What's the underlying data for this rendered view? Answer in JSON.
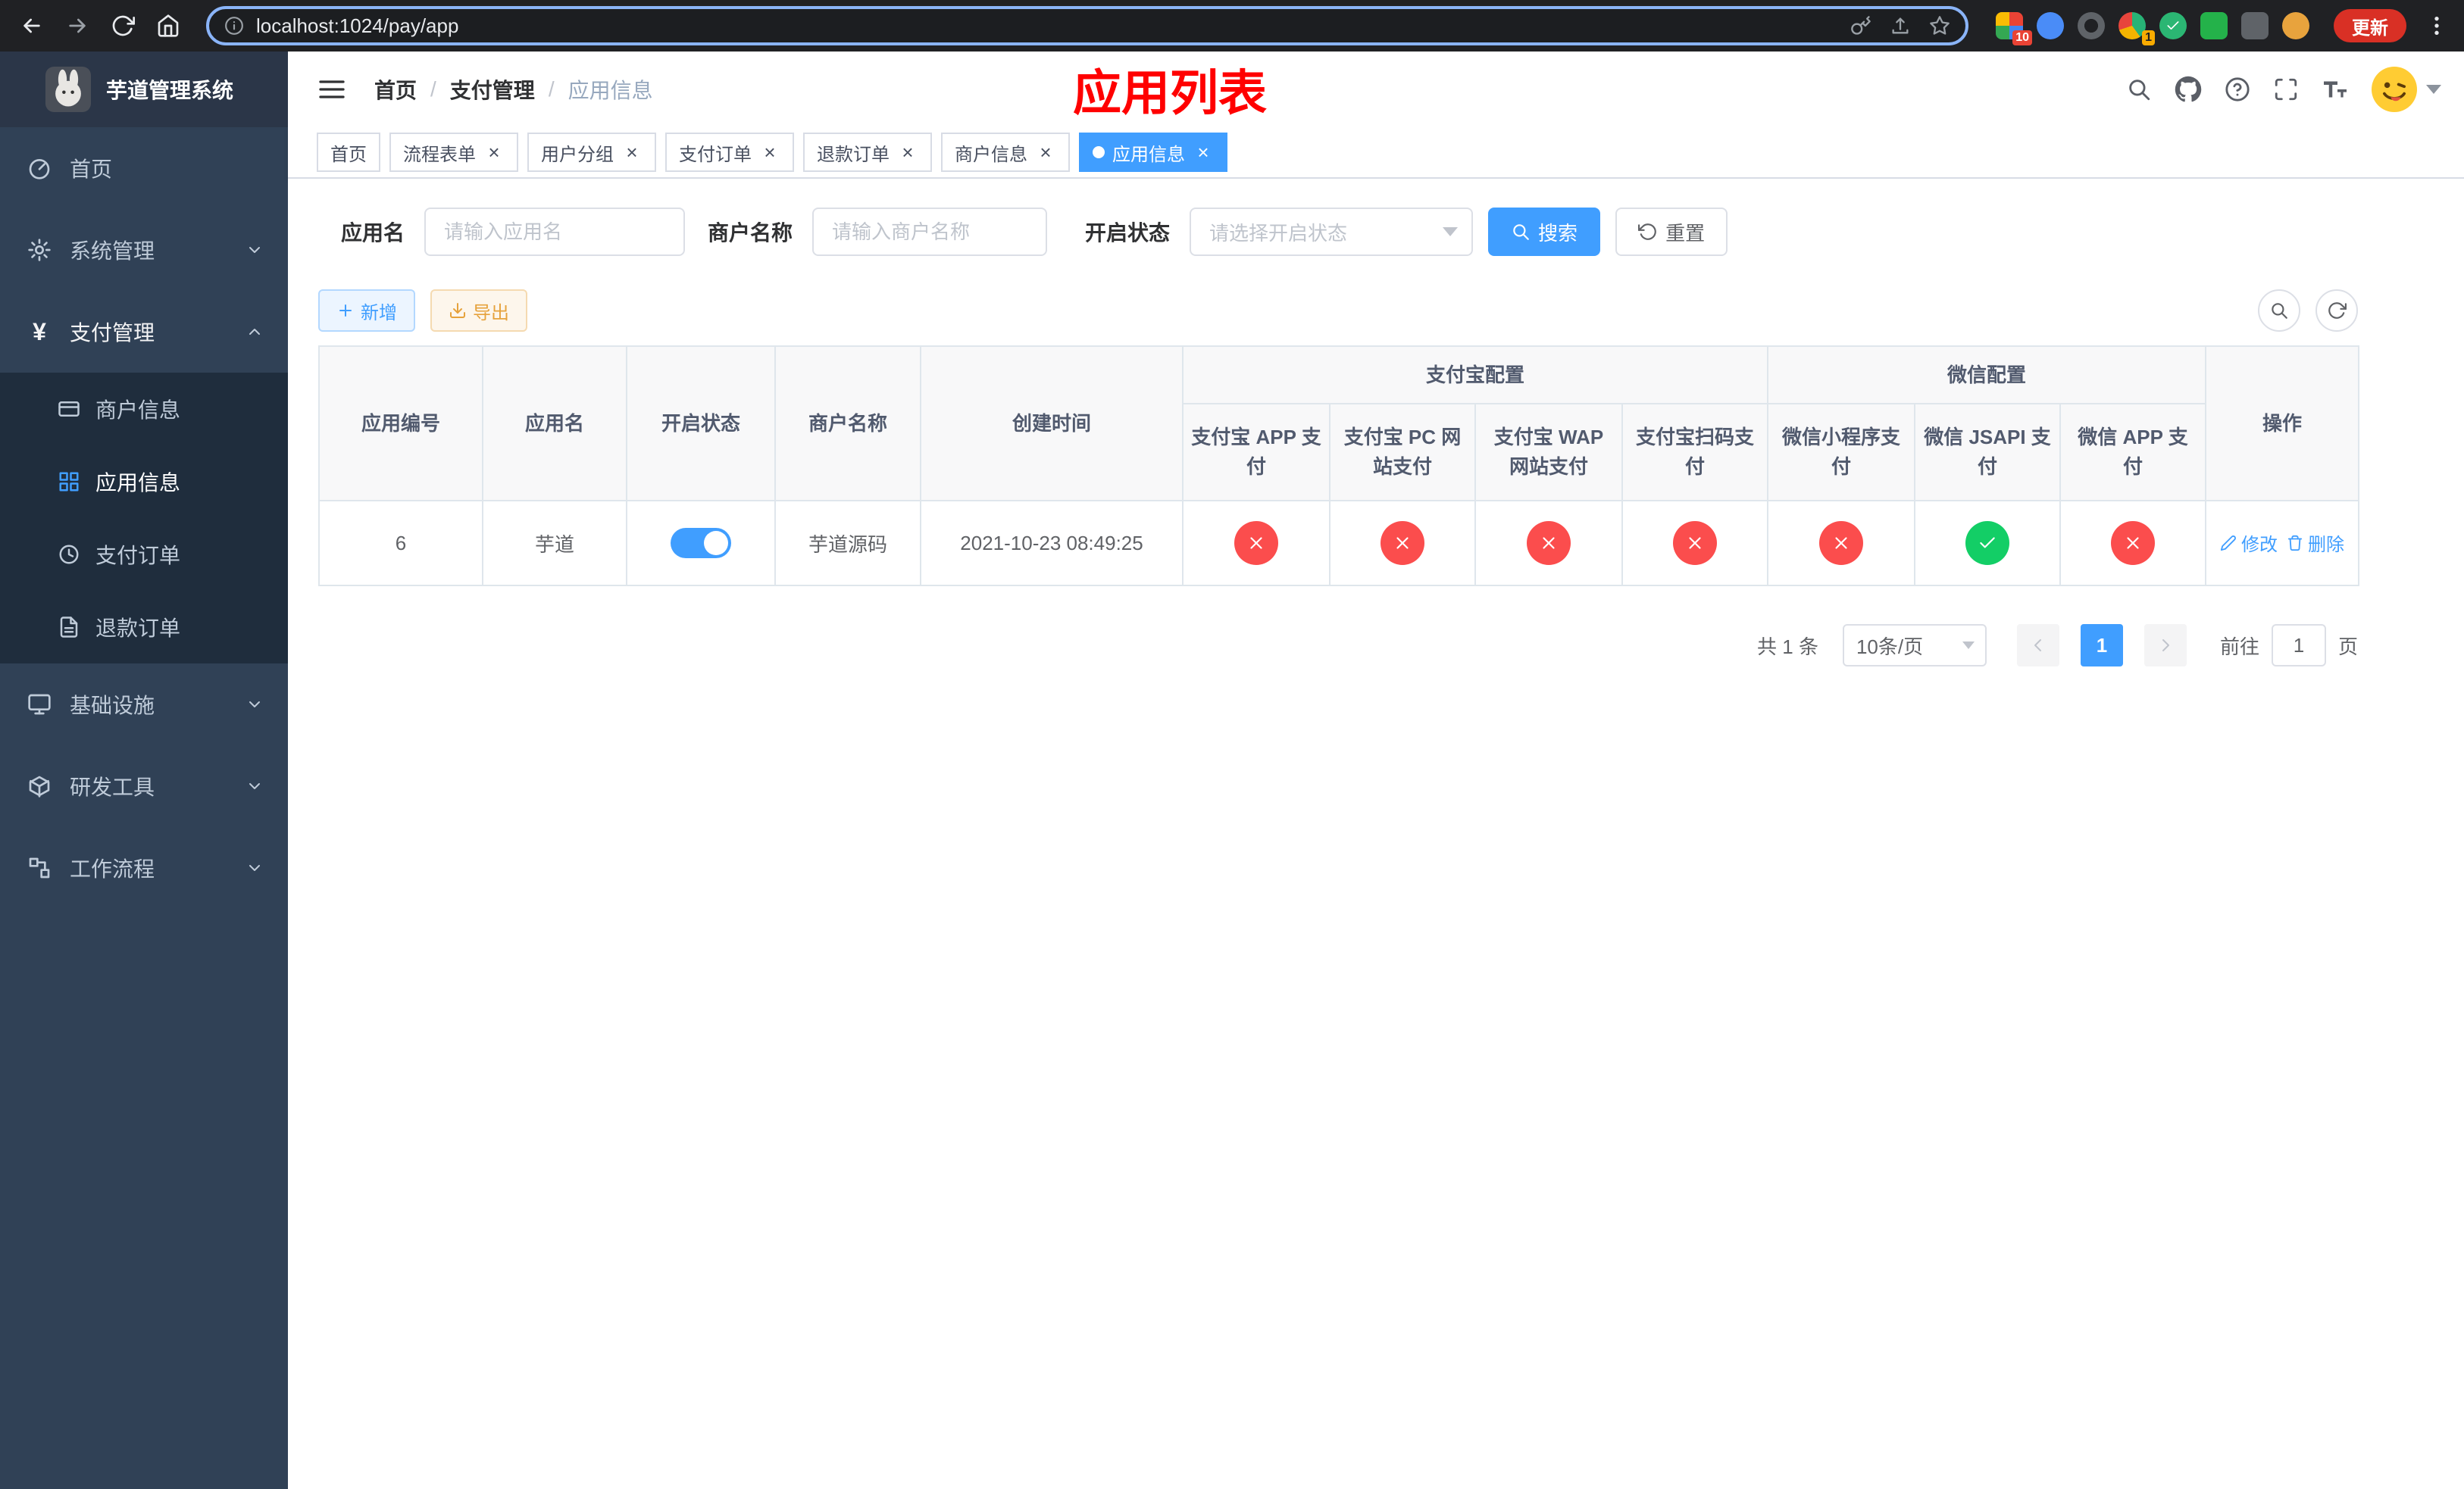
{
  "browser": {
    "url": "localhost:1024/pay/app",
    "update_label": "更新",
    "tab_badge": "10",
    "ext_badge": "1"
  },
  "sidebar": {
    "title": "芋道管理系统",
    "menu": [
      {
        "label": "首页"
      },
      {
        "label": "系统管理"
      },
      {
        "label": "支付管理",
        "children": [
          {
            "label": "商户信息"
          },
          {
            "label": "应用信息"
          },
          {
            "label": "支付订单"
          },
          {
            "label": "退款订单"
          }
        ]
      },
      {
        "label": "基础设施"
      },
      {
        "label": "研发工具"
      },
      {
        "label": "工作流程"
      }
    ]
  },
  "header": {
    "breadcrumb": [
      "首页",
      "支付管理",
      "应用信息"
    ],
    "page_title": "应用列表"
  },
  "tabs": [
    {
      "label": "首页"
    },
    {
      "label": "流程表单"
    },
    {
      "label": "用户分组"
    },
    {
      "label": "支付订单"
    },
    {
      "label": "退款订单"
    },
    {
      "label": "商户信息"
    },
    {
      "label": "应用信息"
    }
  ],
  "filters": {
    "app_name_label": "应用名",
    "app_name_placeholder": "请输入应用名",
    "merchant_label": "商户名称",
    "merchant_placeholder": "请输入商户名称",
    "status_label": "开启状态",
    "status_placeholder": "请选择开启状态",
    "search_label": "搜索",
    "reset_label": "重置"
  },
  "toolbar": {
    "add_label": "新增",
    "export_label": "导出"
  },
  "table": {
    "fixed_columns": [
      "应用编号",
      "应用名",
      "开启状态",
      "商户名称",
      "创建时间"
    ],
    "alipay_group_label": "支付宝配置",
    "wechat_group_label": "微信配置",
    "alipay_columns": [
      "支付宝 APP 支付",
      "支付宝 PC 网站支付",
      "支付宝 WAP 网站支付",
      "支付宝扫码支付"
    ],
    "wechat_columns": [
      "微信小程序支付",
      "微信 JSAPI 支付",
      "微信 APP 支付"
    ],
    "op_column": "操作",
    "rows": [
      {
        "app_id": "6",
        "app_name": "芋道",
        "enabled": true,
        "merchant_name": "芋道源码",
        "create_time": "2021-10-23 08:49:25",
        "configs": {
          "alipay_app": false,
          "alipay_pc": false,
          "alipay_wap": false,
          "alipay_scan": false,
          "wechat_mini": false,
          "wechat_jsapi": true,
          "wechat_app": false
        },
        "edit_label": "修改",
        "delete_label": "删除"
      }
    ]
  },
  "pagination": {
    "total_text": "共 1 条",
    "page_size_text": "10条/页",
    "page_number": "1",
    "goto_label": "前往",
    "goto_value": "1",
    "page_unit_label": "页"
  },
  "colors": {
    "primary": "#409eff",
    "success": "#13ce66",
    "danger": "#fb4d4d",
    "warning": "#e6a23c",
    "title_red": "#ff0000"
  }
}
